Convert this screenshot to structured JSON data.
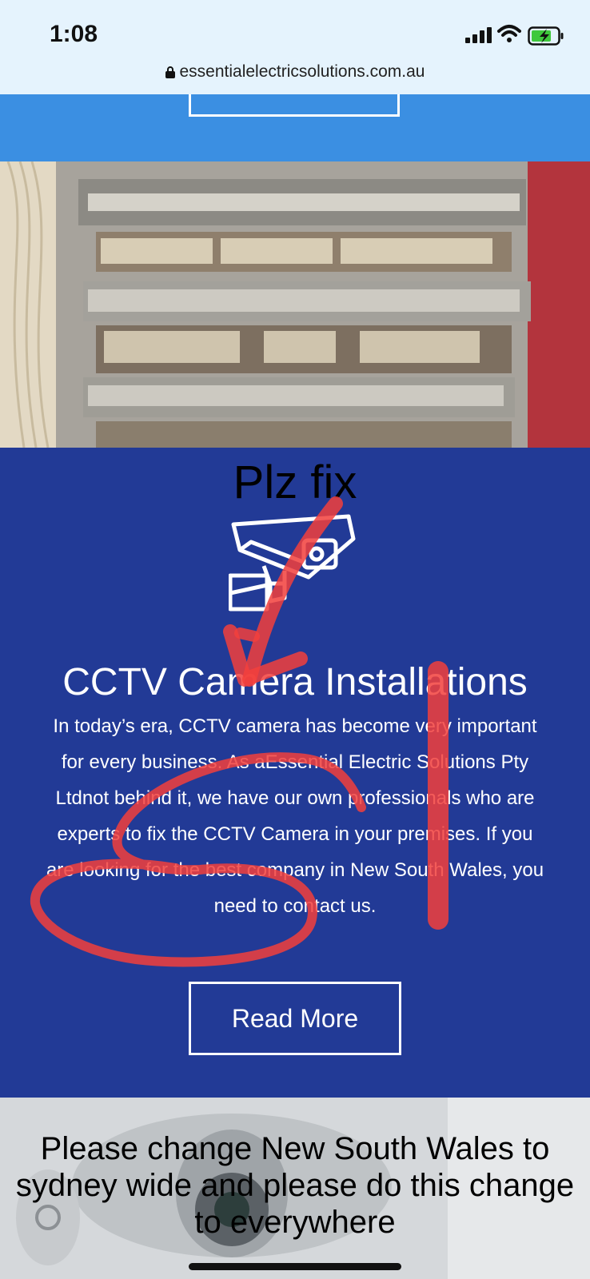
{
  "status_bar": {
    "time": "1:08",
    "url": "essentialelectricsolutions.com.au"
  },
  "annotation": {
    "top_note": "Plz fix",
    "bottom_note": "Please change New South Wales to sydney wide and please do this change to everywhere"
  },
  "service": {
    "title": "CCTV Camera Installations",
    "body": "In today’s era, CCTV camera has become very important for every business. As aEssential Electric Solutions Pty Ltdnot behind it, we have our own professionals who are experts to fix the CCTV Camera in your premises. If you are looking for the best company in New South Wales, you need to contact us.",
    "button_label": "Read More"
  },
  "colors": {
    "header_blue": "#3b8fe2",
    "section_blue": "#223a96",
    "annotation_red": "#f2403c"
  },
  "icons": [
    "lock-icon",
    "signal-icon",
    "wifi-icon",
    "battery-icon",
    "cctv-camera-icon"
  ]
}
